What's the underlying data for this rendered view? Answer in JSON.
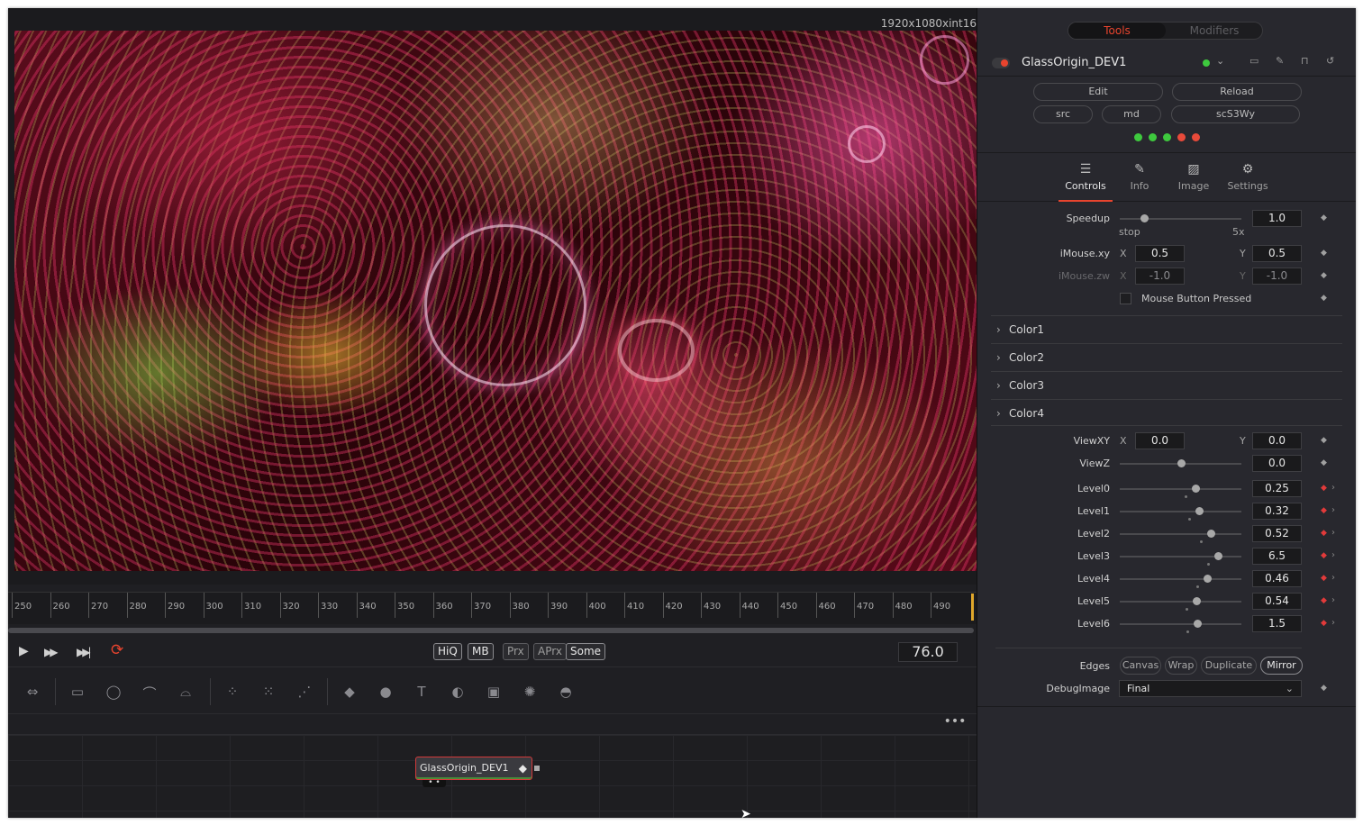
{
  "viewer": {
    "resolution": "1920x1080xint16"
  },
  "ruler": {
    "ticks": [
      "250",
      "260",
      "270",
      "280",
      "290",
      "300",
      "310",
      "320",
      "330",
      "340",
      "350",
      "360",
      "370",
      "380",
      "390",
      "400",
      "410",
      "420",
      "430",
      "440",
      "450",
      "460",
      "470",
      "480",
      "490"
    ]
  },
  "transport": {
    "play": "▶",
    "fast_forward": "▶▶",
    "to_end": "▶▶|",
    "loop": "⟳",
    "hiq": "HiQ",
    "mb": "MB",
    "prx": "Prx",
    "aprx": "APrx",
    "some": "Some",
    "current_frame": "76.0"
  },
  "nodes": {
    "more": "•••",
    "node_name": "GlassOrigin_DEV1",
    "node_key": "◆",
    "node_inputs": "• •"
  },
  "inspector": {
    "tabs": {
      "tools": "Tools",
      "modifiers": "Modifiers"
    },
    "tool_name": "GlassOrigin_DEV1",
    "buttons": {
      "edit": "Edit",
      "reload": "Reload",
      "src": "src",
      "md": "md",
      "hash": "scS3Wy"
    },
    "status_colors": [
      "#3ec93e",
      "#3ec93e",
      "#3ec93e",
      "#e84a3a",
      "#e84a3a"
    ],
    "panel_tabs": [
      {
        "label": "Controls",
        "icon": "sliders-icon"
      },
      {
        "label": "Info",
        "icon": "info-icon"
      },
      {
        "label": "Image",
        "icon": "image-icon"
      },
      {
        "label": "Settings",
        "icon": "settings-icon"
      }
    ],
    "speedup": {
      "label": "Speedup",
      "value": "1.0",
      "min_label": "stop",
      "max_label": "5x",
      "level": 0.2
    },
    "imouse_xy": {
      "label": "iMouse.xy",
      "x_label": "X",
      "x": "0.5",
      "y_label": "Y",
      "y": "0.5"
    },
    "imouse_zw": {
      "label": "iMouse.zw",
      "x_label": "X",
      "x": "-1.0",
      "y_label": "Y",
      "y": "-1.0"
    },
    "mouse_button": {
      "label": "Mouse Button Pressed",
      "checked": false
    },
    "groups": [
      "Color1",
      "Color2",
      "Color3",
      "Color4"
    ],
    "viewxy": {
      "label": "ViewXY",
      "x_label": "X",
      "x": "0.0",
      "y_label": "Y",
      "y": "0.0"
    },
    "viewz": {
      "label": "ViewZ",
      "value": "0.0",
      "level": 0.5
    },
    "levels": [
      {
        "label": "Level0",
        "value": "0.25",
        "level": 0.62
      },
      {
        "label": "Level1",
        "value": "0.32",
        "level": 0.65
      },
      {
        "label": "Level2",
        "value": "0.52",
        "level": 0.75
      },
      {
        "label": "Level3",
        "value": "6.5",
        "level": 0.81
      },
      {
        "label": "Level4",
        "value": "0.46",
        "level": 0.72
      },
      {
        "label": "Level5",
        "value": "0.54",
        "level": 0.63
      },
      {
        "label": "Level6",
        "value": "1.5",
        "level": 0.64
      }
    ],
    "edges": {
      "label": "Edges",
      "options": [
        "Canvas",
        "Wrap",
        "Duplicate",
        "Mirror"
      ],
      "selected": "Mirror"
    },
    "debugimage": {
      "label": "DebugImage",
      "value": "Final"
    }
  }
}
